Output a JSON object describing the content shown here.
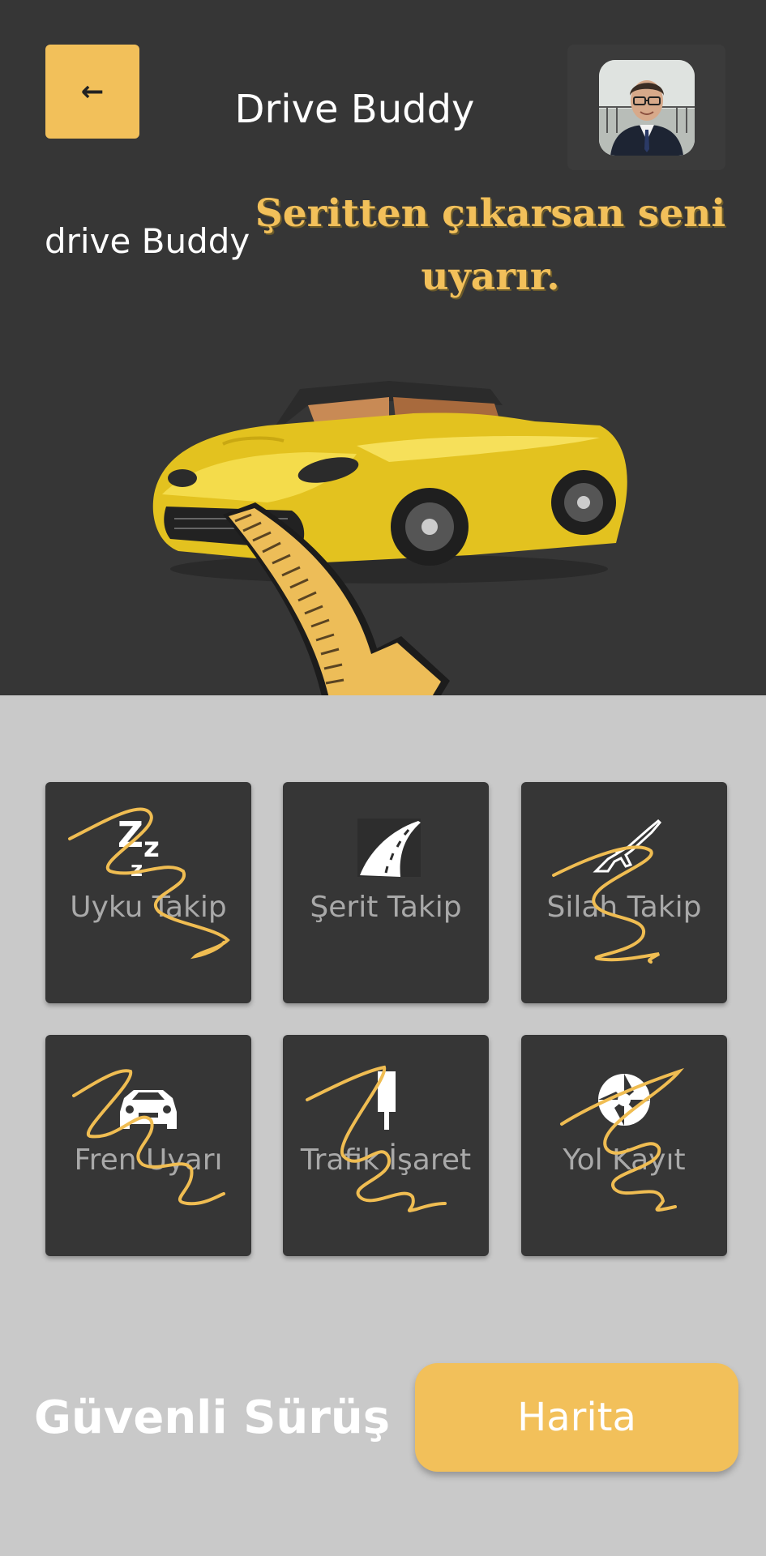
{
  "header": {
    "back_icon": "←",
    "title": "Drive Buddy",
    "avatar": "profile-photo"
  },
  "hero": {
    "brand": "drive Buddy",
    "headline": "Şeritten çıkarsan seni uyarır."
  },
  "features": [
    {
      "label": "Uyku Takip",
      "icon": "sleep-zzz-icon"
    },
    {
      "label": "Şerit Takip",
      "icon": "road-lane-icon"
    },
    {
      "label": "Silah Takip",
      "icon": "rifle-icon"
    },
    {
      "label": "Fren Uyarı",
      "icon": "car-front-icon"
    },
    {
      "label": "Trafik İşaret",
      "icon": "traffic-light-icon"
    },
    {
      "label": "Yol Kayıt",
      "icon": "camera-shutter-icon"
    }
  ],
  "footer": {
    "title": "Güvenli Sürüş",
    "map_button": "Harita"
  },
  "colors": {
    "dark": "#363636",
    "light": "#c9c9c9",
    "accent": "#f2c05a"
  }
}
